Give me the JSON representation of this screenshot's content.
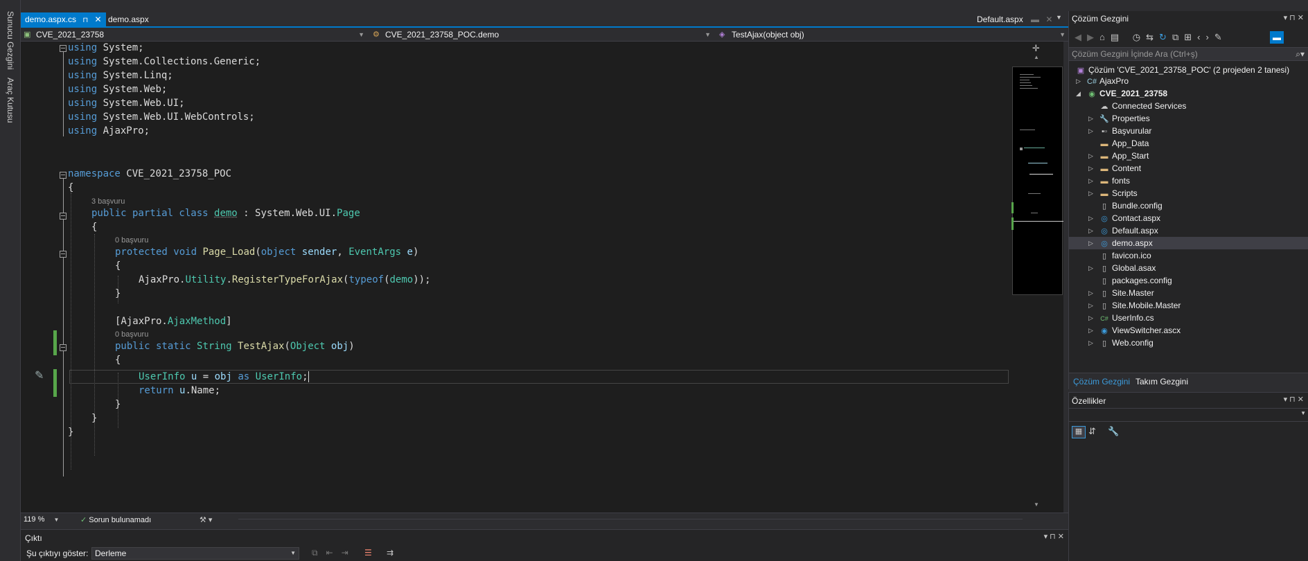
{
  "left_strip": {
    "tab1": "Sunucu Gezgini",
    "tab2": "Araç Kutusu"
  },
  "tabs": [
    {
      "label": "demo.aspx.cs",
      "pin": "⊓",
      "close": "✕"
    },
    {
      "label": "demo.aspx"
    }
  ],
  "right_tab": {
    "label": "Default.aspx"
  },
  "navbar": {
    "project": "CVE_2021_23758",
    "class": "CVE_2021_23758_POC.demo",
    "member": "TestAjax(object obj)"
  },
  "code": {
    "using_kw": "using",
    "usings": [
      "System;",
      "System.Collections.Generic;",
      "System.Linq;",
      "System.Web;",
      "System.Web.UI;",
      "System.Web.UI.WebControls;",
      "AjaxPro;"
    ],
    "namespace_kw": "namespace",
    "namespace_name": "CVE_2021_23758_POC",
    "open_brace": "{",
    "close_brace": "}",
    "class_refs": "3 başvuru",
    "class_kw": "public partial class",
    "class_name": "demo",
    "class_base_sep": " : System.Web.UI.",
    "class_base": "Page",
    "pl_refs": "0 başvuru",
    "pl_kw": "protected void",
    "pl_name": "Page_Load",
    "pl_open": "(",
    "pl_obj": "object",
    "pl_sender": "sender",
    "pl_comma": ", ",
    "pl_ea": "EventArgs",
    "pl_e": "e",
    "pl_close": ")",
    "reg_pre": "AjaxPro.",
    "reg_util": "Utility",
    "reg_dot": ".",
    "reg_fn": "RegisterTypeForAjax",
    "reg_open": "(",
    "reg_typeof": "typeof",
    "reg_mid": "(",
    "reg_demo": "demo",
    "reg_end": "));",
    "attr_open": "[AjaxPro.",
    "attr_name": "AjaxMethod",
    "attr_close": "]",
    "ta_refs": "0 başvuru",
    "ta_kw": "public static",
    "ta_type": "String",
    "ta_name": "TestAjax",
    "ta_open": "(",
    "ta_ptype": "Object",
    "ta_pname": "obj",
    "ta_close": ")",
    "l1_type": "UserInfo",
    "l1_var": "u",
    "l1_eq": " = ",
    "l1_obj": "obj",
    "l1_as": "as",
    "l1_type2": "UserInfo",
    "l1_end": ";",
    "l2_kw": "return",
    "l2_var": "u",
    "l2_end": ".Name;"
  },
  "editor_status": {
    "zoom": "119 %",
    "issues": "Sorun bulunamadı"
  },
  "output": {
    "title": "Çıktı",
    "show_label": "Şu çıktıyı göster:",
    "source": "Derleme"
  },
  "solution": {
    "title": "Çözüm Gezgini",
    "search_placeholder": "Çözüm Gezgini İçinde Ara (Ctrl+ş)",
    "root": "Çözüm 'CVE_2021_23758_POC' (2 projeden 2 tanesi)",
    "items": [
      {
        "label": "AjaxPro",
        "icon": "csharp-project-icon"
      },
      {
        "label": "CVE_2021_23758",
        "icon": "web-project-icon"
      },
      {
        "label": "Connected Services",
        "icon": "connected-services-icon"
      },
      {
        "label": "Properties",
        "icon": "wrench-icon"
      },
      {
        "label": "Başvurular",
        "icon": "references-icon"
      },
      {
        "label": "App_Data",
        "icon": "folder-icon"
      },
      {
        "label": "App_Start",
        "icon": "folder-icon"
      },
      {
        "label": "Content",
        "icon": "folder-icon"
      },
      {
        "label": "fonts",
        "icon": "folder-icon"
      },
      {
        "label": "Scripts",
        "icon": "folder-icon"
      },
      {
        "label": "Bundle.config",
        "icon": "config-file-icon"
      },
      {
        "label": "Contact.aspx",
        "icon": "aspx-file-icon"
      },
      {
        "label": "Default.aspx",
        "icon": "aspx-file-icon"
      },
      {
        "label": "demo.aspx",
        "icon": "aspx-file-icon"
      },
      {
        "label": "favicon.ico",
        "icon": "file-icon"
      },
      {
        "label": "Global.asax",
        "icon": "asax-file-icon"
      },
      {
        "label": "packages.config",
        "icon": "config-file-icon"
      },
      {
        "label": "Site.Master",
        "icon": "master-file-icon"
      },
      {
        "label": "Site.Mobile.Master",
        "icon": "master-file-icon"
      },
      {
        "label": "UserInfo.cs",
        "icon": "csharp-file-icon"
      },
      {
        "label": "ViewSwitcher.ascx",
        "icon": "ascx-file-icon"
      },
      {
        "label": "Web.config",
        "icon": "config-file-icon"
      }
    ],
    "tabs": [
      "Çözüm Gezgini",
      "Takım Gezgini"
    ]
  },
  "properties": {
    "title": "Özellikler"
  },
  "colors": {
    "accent": "#007acc",
    "editor_bg": "#1e1e1e",
    "keyword": "#569cd6",
    "type": "#4ec9b0",
    "method": "#dcdcaa",
    "param": "#9cdcfe",
    "change_bar": "#57a64a"
  }
}
